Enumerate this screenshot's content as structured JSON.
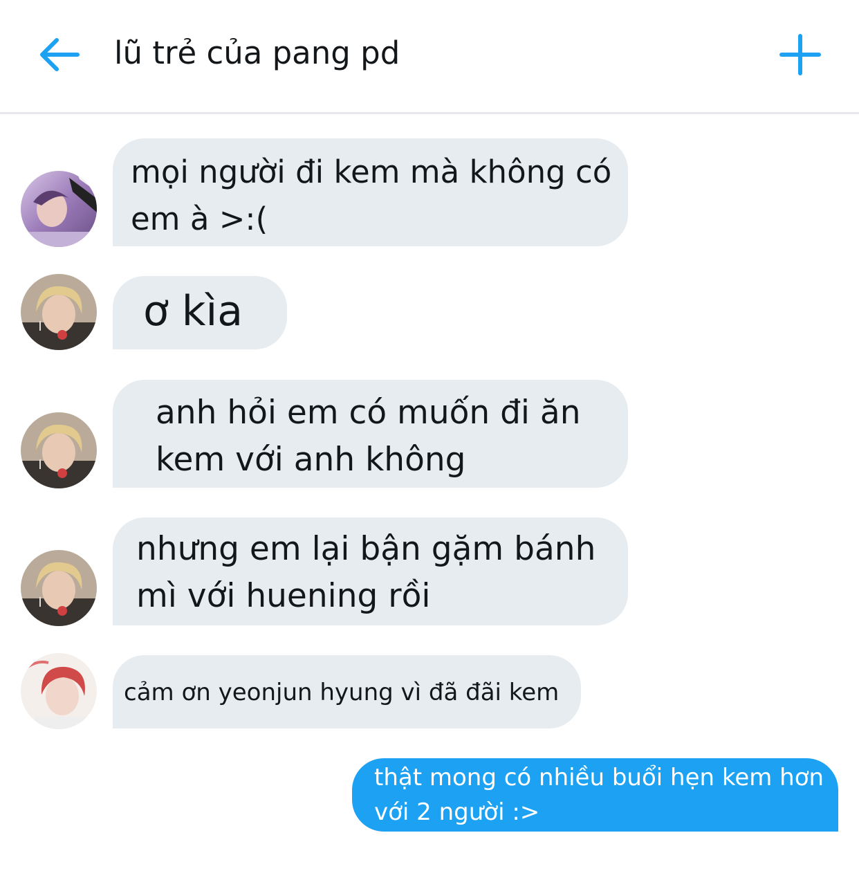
{
  "header": {
    "title": "lũ trẻ của pang pd",
    "back_icon": "arrow-left-icon",
    "add_icon": "plus-icon",
    "accent_color": "#1da1f2"
  },
  "messages": [
    {
      "sender": "incoming",
      "avatar": "avatar-purple",
      "lines": [
        "mọi người đi kem mà không có",
        "em à >:("
      ]
    },
    {
      "sender": "incoming",
      "avatar": "avatar-blonde",
      "lines": [
        "ơ kìa"
      ]
    },
    {
      "sender": "incoming",
      "avatar": "avatar-blonde",
      "lines": [
        "anh hỏi em có muốn đi ăn",
        "kem với anh không"
      ]
    },
    {
      "sender": "incoming",
      "avatar": "avatar-blonde",
      "lines": [
        "nhưng em lại bận gặm bánh",
        "mì với huening rồi"
      ]
    },
    {
      "sender": "incoming",
      "avatar": "avatar-red",
      "lines": [
        "cảm ơn yeonjun hyung vì đã đãi kem"
      ]
    },
    {
      "sender": "outgoing",
      "lines": [
        "thật mong có nhiều buổi hẹn kem hơn",
        "với 2 người :>"
      ]
    }
  ],
  "colors": {
    "incoming_bubble": "#e6ecf0",
    "outgoing_bubble": "#1da1f2",
    "text": "#14171a"
  }
}
